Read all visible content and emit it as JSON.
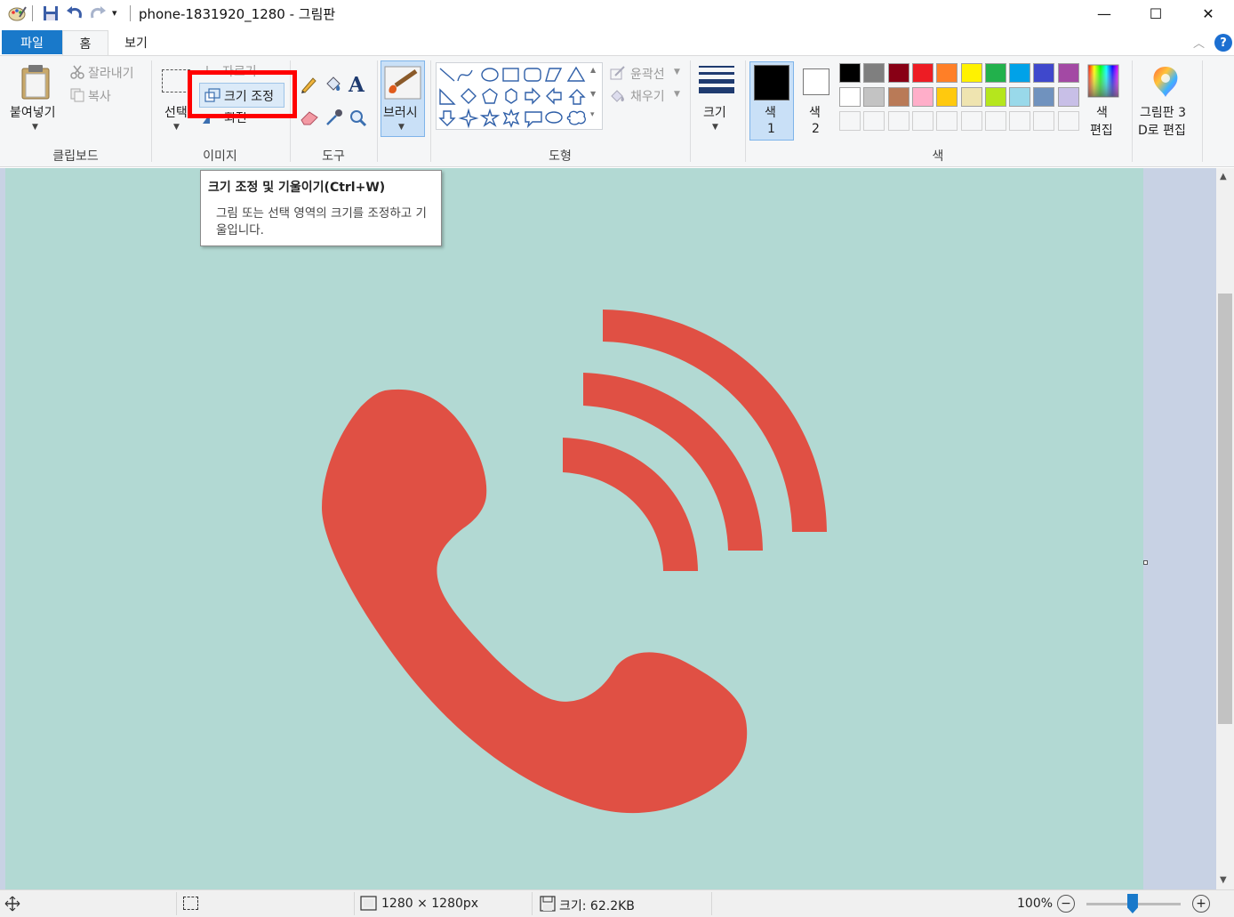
{
  "window": {
    "title": "phone-1831920_1280 - 그림판",
    "minimize": "—",
    "maximize": "☐",
    "close": "✕"
  },
  "tabs": {
    "file": "파일",
    "home": "홈",
    "view": "보기"
  },
  "ribbon": {
    "clipboard": {
      "paste": "붙여넣기",
      "cut": "잘라내기",
      "copy": "복사",
      "group": "클립보드"
    },
    "image": {
      "select": "선택",
      "crop": "자르기",
      "resize": "크기 조정",
      "rotate": "회전",
      "group": "이미지"
    },
    "tools": {
      "group": "도구"
    },
    "brush": {
      "label": "브러시"
    },
    "shapes": {
      "outline": "윤곽선",
      "fill": "채우기",
      "group": "도형"
    },
    "size": {
      "label": "크기"
    },
    "colors": {
      "color1_a": "색",
      "color1_b": "1",
      "color2_a": "색",
      "color2_b": "2",
      "edit_a": "색",
      "edit_b": "편집",
      "group": "색",
      "color1_value": "#000000",
      "color2_value": "#ffffff",
      "palette_row1": [
        "#000000",
        "#7f7f7f",
        "#880015",
        "#ed1c24",
        "#ff7f27",
        "#fff200",
        "#22b14c",
        "#00a2e8",
        "#3f48cc",
        "#a349a4"
      ],
      "palette_row2": [
        "#ffffff",
        "#c3c3c3",
        "#b97a57",
        "#ffaec9",
        "#ffc90e",
        "#efe4b0",
        "#b5e61d",
        "#99d9ea",
        "#7092be",
        "#c8bfe7"
      ]
    },
    "paint3d": {
      "line1": "그림판 3",
      "line2": "D로 편집"
    }
  },
  "tooltip": {
    "title": "크기 조정 및 기울이기(Ctrl+W)",
    "body": "그림 또는 선택 영역의 크기를 조정하고 기울입니다."
  },
  "canvas": {
    "background": "#b2d9d3",
    "phone_color": "#e05044"
  },
  "status": {
    "dimensions": "1280 × 1280px",
    "filesize": "크기: 62.2KB",
    "zoom": "100%"
  }
}
